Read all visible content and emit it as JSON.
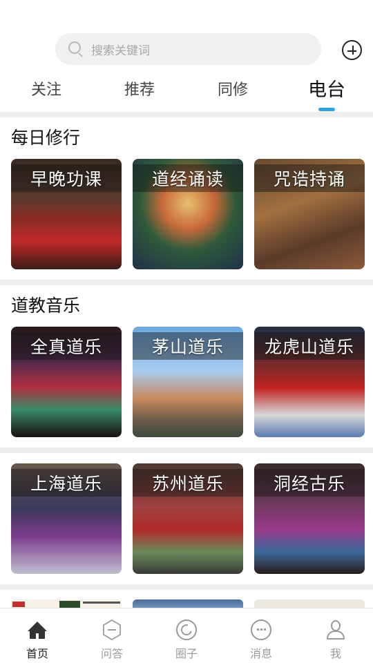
{
  "search": {
    "placeholder": "搜索关键词"
  },
  "tabs": [
    {
      "label": "关注",
      "active": false
    },
    {
      "label": "推荐",
      "active": false
    },
    {
      "label": "同修",
      "active": false
    },
    {
      "label": "电台",
      "active": true
    }
  ],
  "sections": [
    {
      "title": "每日修行",
      "cards": [
        {
          "label": "早晚功课"
        },
        {
          "label": "道经诵读"
        },
        {
          "label": "咒诰持诵"
        }
      ]
    },
    {
      "title": "道教音乐",
      "cards": [
        {
          "label": "全真道乐"
        },
        {
          "label": "茅山道乐"
        },
        {
          "label": "龙虎山道乐"
        }
      ]
    },
    {
      "title": "",
      "cards": [
        {
          "label": "上海道乐"
        },
        {
          "label": "苏州道乐"
        },
        {
          "label": "洞经古乐"
        }
      ]
    }
  ],
  "bottom_nav": [
    {
      "label": "首页",
      "icon": "home-icon",
      "active": true
    },
    {
      "label": "问答",
      "icon": "qa-icon",
      "active": false
    },
    {
      "label": "圈子",
      "icon": "circle-icon",
      "active": false
    },
    {
      "label": "消息",
      "icon": "message-icon",
      "active": false
    },
    {
      "label": "我",
      "icon": "profile-icon",
      "active": false
    }
  ],
  "colors": {
    "accent": "#2aa3e8",
    "separator": "#eeeeee"
  }
}
